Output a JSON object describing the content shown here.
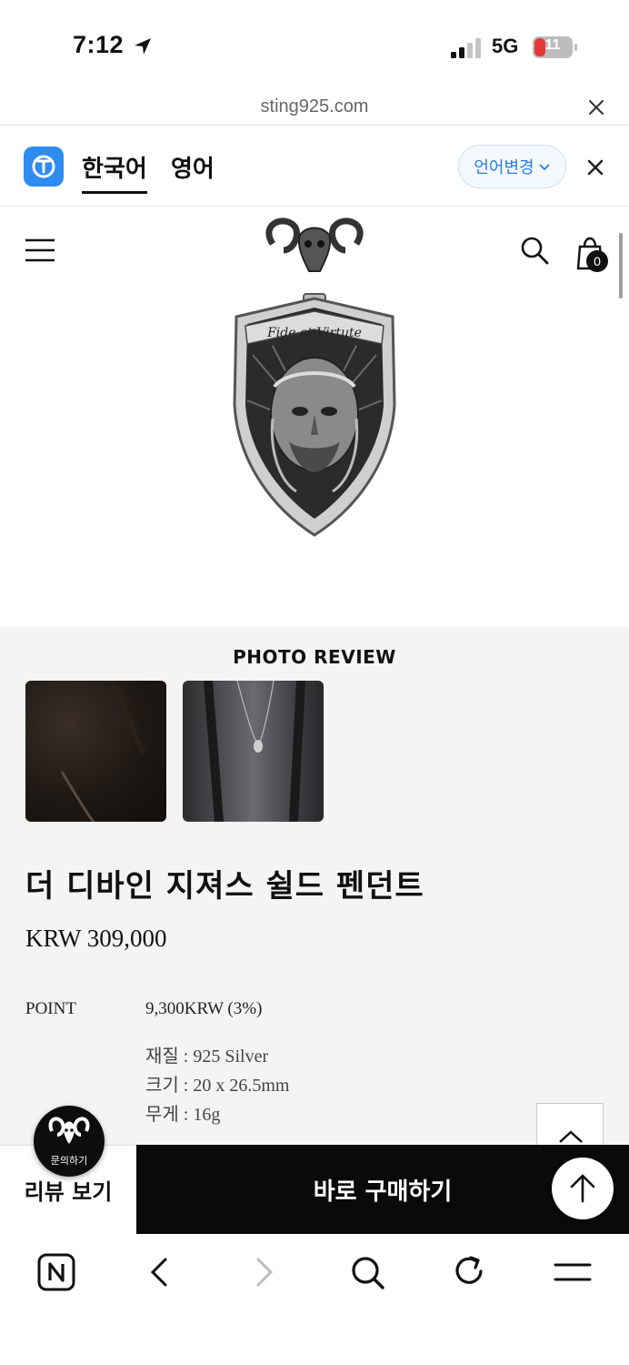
{
  "status_bar": {
    "time": "7:12",
    "network": "5G",
    "battery": "11"
  },
  "url_bar": {
    "url": "sting925.com"
  },
  "translate_bar": {
    "tab_korean": "한국어",
    "tab_english": "영어",
    "change_language": "언어변경"
  },
  "header": {
    "cart_count": "0"
  },
  "review": {
    "title": "PHOTO REVIEW"
  },
  "product": {
    "name": "더 디바인 지져스 쉴드 펜던트",
    "price": "KRW 309,000",
    "point_label": "POINT",
    "point_value": "9,300KRW (3%)",
    "specs": [
      "재질 : 925 Silver",
      "크기 : 20 x 26.5mm",
      "무게 : 16g"
    ]
  },
  "inquiry": {
    "label": "문의하기"
  },
  "purchase_bar": {
    "review_label": "리뷰 보기",
    "buy_label": "바로 구매하기"
  },
  "colors": {
    "accent_blue": "#2e8cf0",
    "buy_button": "#0a0a0a",
    "content_bg": "#f4f4f4"
  }
}
